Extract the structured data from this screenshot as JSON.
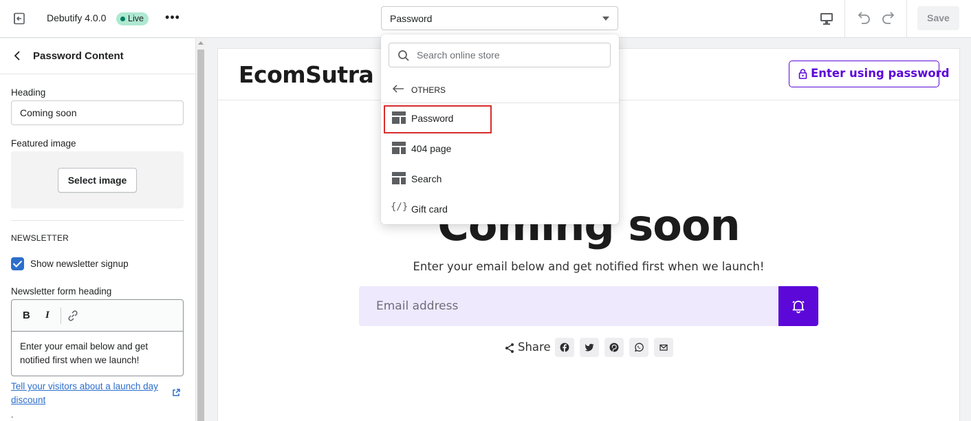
{
  "topbar": {
    "theme_name": "Debutify 4.0.0",
    "live_badge": "Live",
    "more_label": "•••",
    "page_select_value": "Password",
    "save_label": "Save"
  },
  "sidebar": {
    "title": "Password Content",
    "heading_label": "Heading",
    "heading_value": "Coming soon",
    "featured_image_label": "Featured image",
    "select_image_label": "Select image",
    "newsletter_section": "NEWSLETTER",
    "show_newsletter_label": "Show newsletter signup",
    "show_newsletter_checked": true,
    "form_heading_label": "Newsletter form heading",
    "rte_bold": "B",
    "rte_italic": "I",
    "form_heading_value": "Enter your email below and get notified first when we launch!",
    "launch_link": "Tell your visitors about a launch day discount",
    "trailing_dot": "."
  },
  "preview": {
    "store_name": "EcomSutra I",
    "enter_password_label": "Enter using password",
    "coming_soon": "Coming soon",
    "subheading": "Enter your email below and get notified first when we launch!",
    "email_placeholder": "Email address",
    "share_label": "Share",
    "social_icons": [
      "facebook-icon",
      "twitter-icon",
      "pinterest-icon",
      "whatsapp-icon",
      "email-icon"
    ]
  },
  "dropdown": {
    "search_placeholder": "Search online store",
    "section_label": "OTHERS",
    "items": [
      {
        "label": "Password",
        "icon": "template-icon",
        "highlighted": true
      },
      {
        "label": "404 page",
        "icon": "template-icon"
      },
      {
        "label": "Search",
        "icon": "template-icon"
      },
      {
        "label": "Gift card",
        "icon": "code-icon",
        "glyph": "{/}"
      }
    ]
  },
  "colors": {
    "accent": "#5c08d8",
    "email_bg": "#efe9fd",
    "live_badge_bg": "#aee9d1",
    "checkbox": "#2c6ecb",
    "highlight": "#d82c2c"
  }
}
